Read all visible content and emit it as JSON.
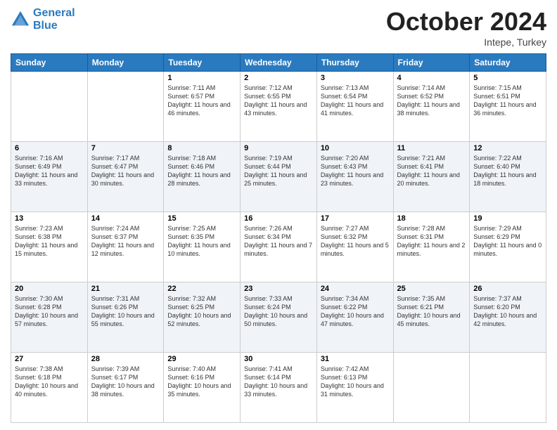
{
  "header": {
    "logo_line1": "General",
    "logo_line2": "Blue",
    "month": "October 2024",
    "location": "Intepe, Turkey"
  },
  "days_of_week": [
    "Sunday",
    "Monday",
    "Tuesday",
    "Wednesday",
    "Thursday",
    "Friday",
    "Saturday"
  ],
  "weeks": [
    [
      {
        "day": "",
        "content": ""
      },
      {
        "day": "",
        "content": ""
      },
      {
        "day": "1",
        "content": "Sunrise: 7:11 AM\nSunset: 6:57 PM\nDaylight: 11 hours and 46 minutes."
      },
      {
        "day": "2",
        "content": "Sunrise: 7:12 AM\nSunset: 6:55 PM\nDaylight: 11 hours and 43 minutes."
      },
      {
        "day": "3",
        "content": "Sunrise: 7:13 AM\nSunset: 6:54 PM\nDaylight: 11 hours and 41 minutes."
      },
      {
        "day": "4",
        "content": "Sunrise: 7:14 AM\nSunset: 6:52 PM\nDaylight: 11 hours and 38 minutes."
      },
      {
        "day": "5",
        "content": "Sunrise: 7:15 AM\nSunset: 6:51 PM\nDaylight: 11 hours and 36 minutes."
      }
    ],
    [
      {
        "day": "6",
        "content": "Sunrise: 7:16 AM\nSunset: 6:49 PM\nDaylight: 11 hours and 33 minutes."
      },
      {
        "day": "7",
        "content": "Sunrise: 7:17 AM\nSunset: 6:47 PM\nDaylight: 11 hours and 30 minutes."
      },
      {
        "day": "8",
        "content": "Sunrise: 7:18 AM\nSunset: 6:46 PM\nDaylight: 11 hours and 28 minutes."
      },
      {
        "day": "9",
        "content": "Sunrise: 7:19 AM\nSunset: 6:44 PM\nDaylight: 11 hours and 25 minutes."
      },
      {
        "day": "10",
        "content": "Sunrise: 7:20 AM\nSunset: 6:43 PM\nDaylight: 11 hours and 23 minutes."
      },
      {
        "day": "11",
        "content": "Sunrise: 7:21 AM\nSunset: 6:41 PM\nDaylight: 11 hours and 20 minutes."
      },
      {
        "day": "12",
        "content": "Sunrise: 7:22 AM\nSunset: 6:40 PM\nDaylight: 11 hours and 18 minutes."
      }
    ],
    [
      {
        "day": "13",
        "content": "Sunrise: 7:23 AM\nSunset: 6:38 PM\nDaylight: 11 hours and 15 minutes."
      },
      {
        "day": "14",
        "content": "Sunrise: 7:24 AM\nSunset: 6:37 PM\nDaylight: 11 hours and 12 minutes."
      },
      {
        "day": "15",
        "content": "Sunrise: 7:25 AM\nSunset: 6:35 PM\nDaylight: 11 hours and 10 minutes."
      },
      {
        "day": "16",
        "content": "Sunrise: 7:26 AM\nSunset: 6:34 PM\nDaylight: 11 hours and 7 minutes."
      },
      {
        "day": "17",
        "content": "Sunrise: 7:27 AM\nSunset: 6:32 PM\nDaylight: 11 hours and 5 minutes."
      },
      {
        "day": "18",
        "content": "Sunrise: 7:28 AM\nSunset: 6:31 PM\nDaylight: 11 hours and 2 minutes."
      },
      {
        "day": "19",
        "content": "Sunrise: 7:29 AM\nSunset: 6:29 PM\nDaylight: 11 hours and 0 minutes."
      }
    ],
    [
      {
        "day": "20",
        "content": "Sunrise: 7:30 AM\nSunset: 6:28 PM\nDaylight: 10 hours and 57 minutes."
      },
      {
        "day": "21",
        "content": "Sunrise: 7:31 AM\nSunset: 6:26 PM\nDaylight: 10 hours and 55 minutes."
      },
      {
        "day": "22",
        "content": "Sunrise: 7:32 AM\nSunset: 6:25 PM\nDaylight: 10 hours and 52 minutes."
      },
      {
        "day": "23",
        "content": "Sunrise: 7:33 AM\nSunset: 6:24 PM\nDaylight: 10 hours and 50 minutes."
      },
      {
        "day": "24",
        "content": "Sunrise: 7:34 AM\nSunset: 6:22 PM\nDaylight: 10 hours and 47 minutes."
      },
      {
        "day": "25",
        "content": "Sunrise: 7:35 AM\nSunset: 6:21 PM\nDaylight: 10 hours and 45 minutes."
      },
      {
        "day": "26",
        "content": "Sunrise: 7:37 AM\nSunset: 6:20 PM\nDaylight: 10 hours and 42 minutes."
      }
    ],
    [
      {
        "day": "27",
        "content": "Sunrise: 7:38 AM\nSunset: 6:18 PM\nDaylight: 10 hours and 40 minutes."
      },
      {
        "day": "28",
        "content": "Sunrise: 7:39 AM\nSunset: 6:17 PM\nDaylight: 10 hours and 38 minutes."
      },
      {
        "day": "29",
        "content": "Sunrise: 7:40 AM\nSunset: 6:16 PM\nDaylight: 10 hours and 35 minutes."
      },
      {
        "day": "30",
        "content": "Sunrise: 7:41 AM\nSunset: 6:14 PM\nDaylight: 10 hours and 33 minutes."
      },
      {
        "day": "31",
        "content": "Sunrise: 7:42 AM\nSunset: 6:13 PM\nDaylight: 10 hours and 31 minutes."
      },
      {
        "day": "",
        "content": ""
      },
      {
        "day": "",
        "content": ""
      }
    ]
  ]
}
